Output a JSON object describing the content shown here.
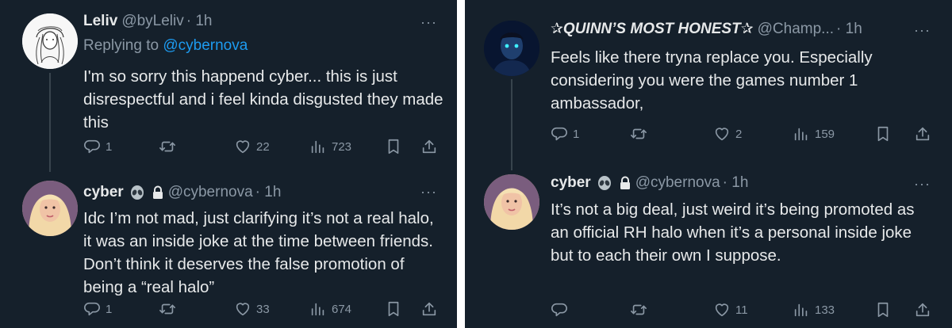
{
  "left": {
    "tweet1": {
      "name": "Leliv",
      "handle": "@byLeliv",
      "time": "· 1h",
      "more": "···",
      "replying_prefix": "Replying to ",
      "replying_handle": "@cybernova",
      "text": "I'm so sorry this happend cyber... this is just disrespectful and i feel kinda disgusted they made this",
      "replies": "1",
      "retweets": "",
      "likes": "22",
      "views": "723"
    },
    "tweet2": {
      "name": "cyber",
      "handle": "@cybernova",
      "time": "· 1h",
      "more": "···",
      "text": "Idc I’m not mad, just clarifying it’s not a real halo, it was an inside joke at the time between friends. Don’t think it deserves the false promotion of being a “real halo”",
      "replies": "1",
      "retweets": "",
      "likes": "33",
      "views": "674"
    }
  },
  "right": {
    "tweet1": {
      "name": "✰QUINN’S MOST HONEST✰",
      "handle": "@Champ...",
      "time": "· 1h",
      "more": "···",
      "text": "Feels like there tryna replace you. Especially considering you were the games number 1 ambassador,",
      "replies": "1",
      "retweets": "",
      "likes": "2",
      "views": "159"
    },
    "tweet2": {
      "name": "cyber",
      "handle": "@cybernova",
      "time": "· 1h",
      "more": "···",
      "text": "It’s not a big deal, just weird it’s being promoted as an official RH halo when it’s a personal inside joke but to each their own I suppose.",
      "replies": "",
      "retweets": "",
      "likes": "11",
      "views": "133"
    }
  },
  "icons": [
    "alien-emoji-icon",
    "lock-icon",
    "reply-icon",
    "retweet-icon",
    "like-icon",
    "views-icon",
    "bookmark-icon",
    "share-icon",
    "more-icon"
  ],
  "colors": {
    "background": "#15202b",
    "text": "#e7e9ea",
    "secondary": "#8b98a5",
    "link": "#1d9bf0",
    "divider": "#ffffff"
  }
}
